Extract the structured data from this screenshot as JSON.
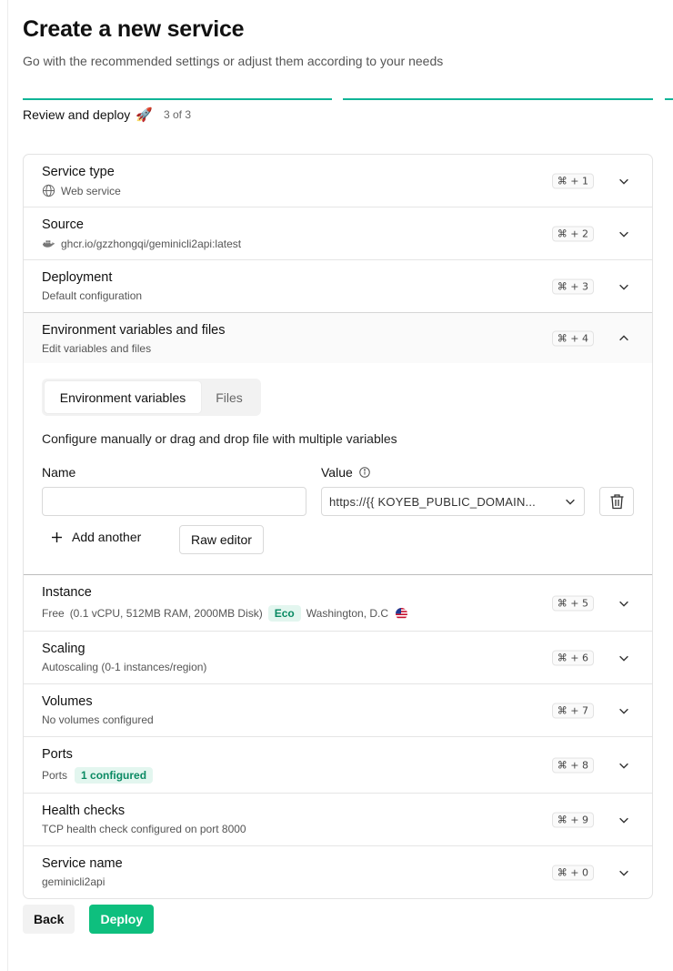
{
  "header": {
    "title": "Create a new service",
    "subtitle": "Go with the recommended settings or adjust them according to your needs"
  },
  "stepper": {
    "label": "Review and deploy",
    "emoji": "🚀",
    "count": "3 of 3",
    "accent_color": "#10b497"
  },
  "sections": {
    "service_type": {
      "title": "Service type",
      "subtitle": "Web service",
      "icon": "globe-icon",
      "shortcut": "⌘ + 1"
    },
    "source": {
      "title": "Source",
      "subtitle": "ghcr.io/gzzhongqi/geminicli2api:latest",
      "icon": "docker-icon",
      "shortcut": "⌘ + 2"
    },
    "deployment": {
      "title": "Deployment",
      "subtitle": "Default configuration",
      "shortcut": "⌘ + 3"
    },
    "environment": {
      "title": "Environment variables and files",
      "subtitle": "Edit variables and files",
      "shortcut": "⌘ + 4",
      "tabs": [
        "Environment variables",
        "Files"
      ],
      "active_tab": "Environment variables",
      "description": "Configure manually or drag and drop file with multiple variables",
      "name_label": "Name",
      "value_label": "Value",
      "name_value": "",
      "value_selected": "https://{{ KOYEB_PUBLIC_DOMAIN...",
      "add_another_label": "Add another",
      "raw_editor_label": "Raw editor"
    },
    "instance": {
      "title": "Instance",
      "plan": "Free",
      "specs": "(0.1 vCPU, 512MB RAM, 2000MB Disk)",
      "badge": "Eco",
      "region": "Washington, D.C",
      "shortcut": "⌘ + 5"
    },
    "scaling": {
      "title": "Scaling",
      "subtitle": "Autoscaling (0-1 instances/region)",
      "shortcut": "⌘ + 6"
    },
    "volumes": {
      "title": "Volumes",
      "subtitle": "No volumes configured",
      "shortcut": "⌘ + 7"
    },
    "ports": {
      "title": "Ports",
      "subtitle": "Ports",
      "badge": "1 configured",
      "shortcut": "⌘ + 8"
    },
    "health_checks": {
      "title": "Health checks",
      "subtitle": "TCP health check configured on port 8000",
      "shortcut": "⌘ + 9"
    },
    "service_name": {
      "title": "Service name",
      "subtitle": "geminicli2api",
      "shortcut": "⌘ + 0"
    }
  },
  "footer": {
    "back_label": "Back",
    "deploy_label": "Deploy",
    "deploy_color": "#0ebf7e"
  }
}
